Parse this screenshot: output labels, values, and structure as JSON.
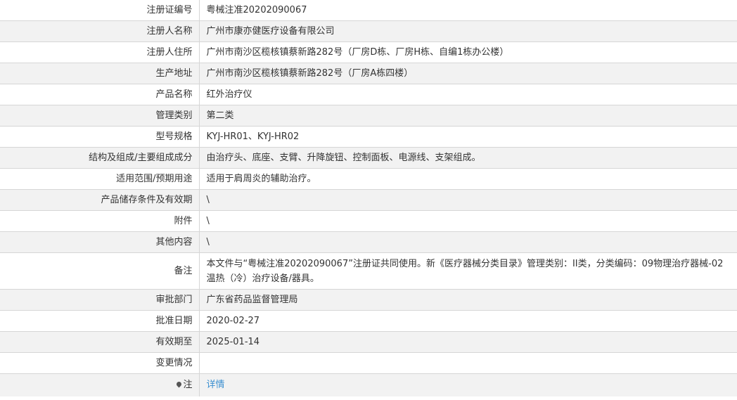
{
  "rows": [
    {
      "label": "注册证编号",
      "value": "粤械注准20202090067"
    },
    {
      "label": "注册人名称",
      "value": "广州市康亦健医疗设备有限公司"
    },
    {
      "label": "注册人住所",
      "value": "广州市南沙区榄核镇蔡新路282号（厂房D栋、厂房H栋、自编1栋办公楼）"
    },
    {
      "label": "生产地址",
      "value": "广州市南沙区榄核镇蔡新路282号（厂房A栋四楼）"
    },
    {
      "label": "产品名称",
      "value": "红外治疗仪"
    },
    {
      "label": "管理类别",
      "value": "第二类"
    },
    {
      "label": "型号规格",
      "value": "KYJ-HR01、KYJ-HR02"
    },
    {
      "label": "结构及组成/主要组成成分",
      "value": "由治疗头、底座、支臂、升降旋钮、控制面板、电源线、支架组成。"
    },
    {
      "label": "适用范围/预期用途",
      "value": "适用于肩周炎的辅助治疗。"
    },
    {
      "label": "产品储存条件及有效期",
      "value": "\\"
    },
    {
      "label": "附件",
      "value": "\\"
    },
    {
      "label": "其他内容",
      "value": "\\"
    },
    {
      "label": "备注",
      "value": "本文件与“粤械注准20202090067”注册证共同使用。新《医疗器械分类目录》管理类别：II类，分类编码：09物理治疗器械-02温热（冷）治疗设备/器具。"
    },
    {
      "label": "审批部门",
      "value": "广东省药品监督管理局"
    },
    {
      "label": "批准日期",
      "value": "2020-02-27"
    },
    {
      "label": "有效期至",
      "value": "2025-01-14"
    },
    {
      "label": "变更情况",
      "value": ""
    }
  ],
  "note": {
    "icon": "pin-icon",
    "label": "注",
    "link_text": "详情",
    "link_color": "#3a8fd0"
  }
}
